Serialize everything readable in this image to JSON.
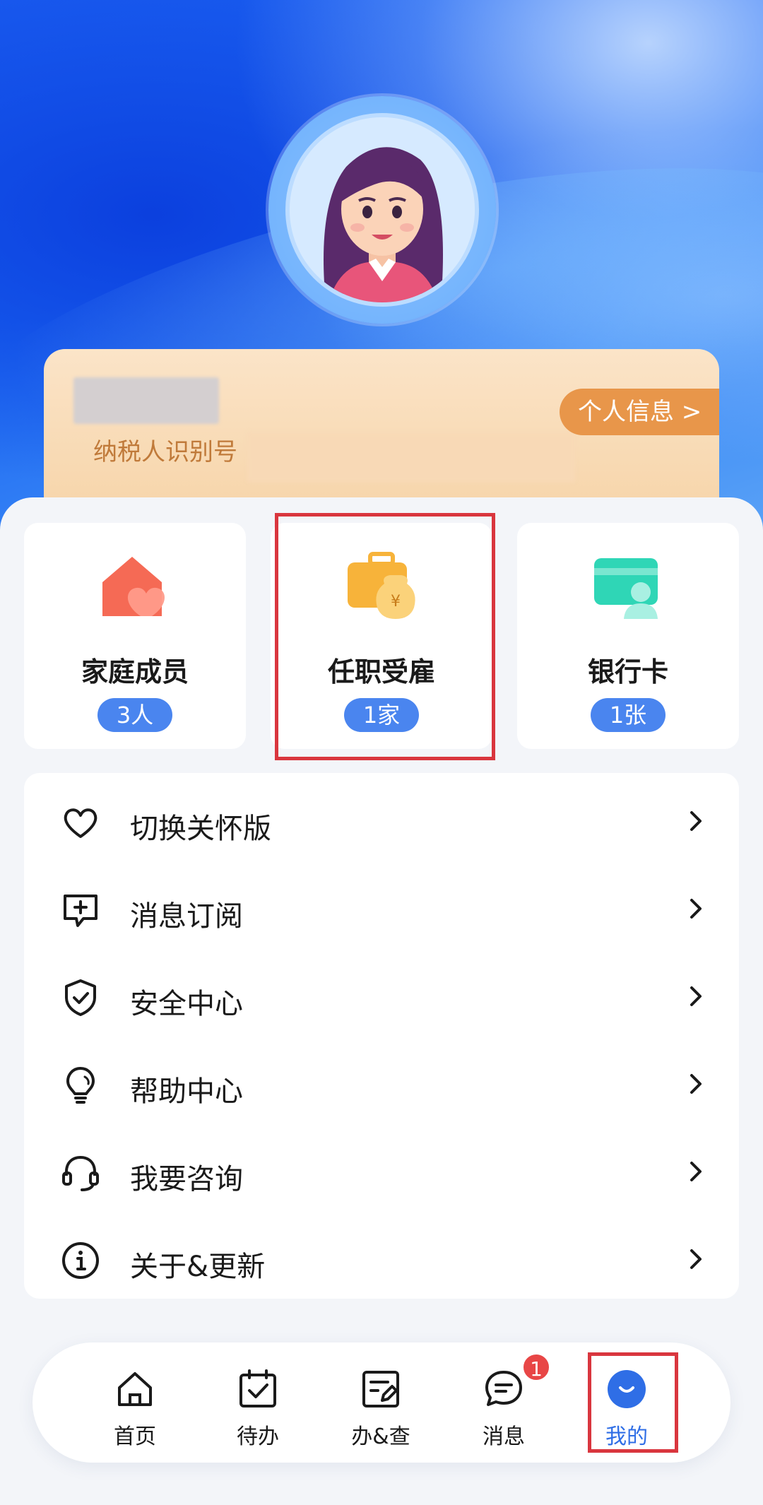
{
  "header": {
    "personal_info_button": "个人信息 >",
    "taxpayer_id_label": "纳税人识别号"
  },
  "tiles": [
    {
      "title": "家庭成员",
      "badge": "3人",
      "icon": "family-house-heart-icon"
    },
    {
      "title": "任职受雇",
      "badge": "1家",
      "icon": "employment-briefcase-money-icon"
    },
    {
      "title": "银行卡",
      "badge": "1张",
      "icon": "bank-card-icon"
    }
  ],
  "menu": [
    {
      "label": "切换关怀版",
      "icon": "heart-icon"
    },
    {
      "label": "消息订阅",
      "icon": "message-add-icon"
    },
    {
      "label": "安全中心",
      "icon": "shield-check-icon"
    },
    {
      "label": "帮助中心",
      "icon": "lightbulb-icon"
    },
    {
      "label": "我要咨询",
      "icon": "headset-icon"
    },
    {
      "label": "关于&更新",
      "icon": "info-icon"
    }
  ],
  "tabbar": [
    {
      "label": "首页",
      "icon": "home-icon"
    },
    {
      "label": "待办",
      "icon": "calendar-check-icon"
    },
    {
      "label": "办&查",
      "icon": "document-edit-icon"
    },
    {
      "label": "消息",
      "icon": "chat-bubble-icon",
      "badge": "1"
    },
    {
      "label": "我的",
      "icon": "profile-smile-icon",
      "active": true
    }
  ],
  "colors": {
    "accent": "#2f6ee6",
    "badge_blue": "#4a85ef",
    "highlight_red": "#d9363e",
    "info_card_orange": "#e8964a"
  }
}
